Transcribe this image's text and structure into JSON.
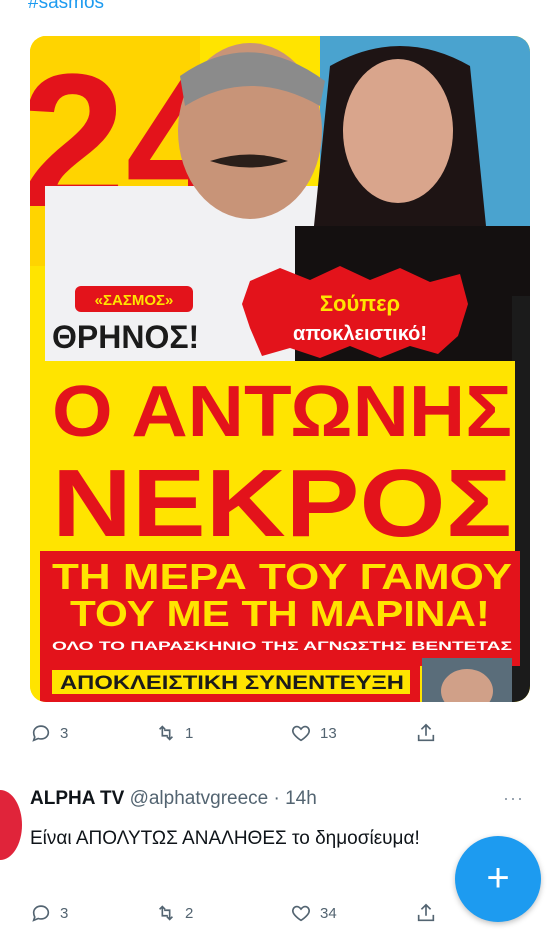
{
  "feed": {
    "hashtag": "#sasmos"
  },
  "magazine": {
    "tag": "«ΣΑΣΜΟΣ»",
    "kicker": "ΘΡΗΝΟΣ!",
    "badge_line1": "Σούπερ",
    "badge_line2": "αποκλειστικό!",
    "headline_line1": "Ο ΑΝΤΩΝΗΣ",
    "headline_line2": "ΝΕΚΡΟΣ",
    "sub_line1": "ΤΗ ΜΕΡΑ ΤΟΥ ΓΑΜΟΥ",
    "sub_line2": "ΤΟΥ ΜΕ ΤΗ ΜΑΡΙΝΑ!",
    "small_line": "ΟΛΟ ΤΟ ΠΑΡΑΣΚΗΝΙΟ ΤΗΣ ΑΓΝΩΣΤΗΣ ΒΕΝΤΕΤΑΣ",
    "bottom_strip": "ΑΠΟΚΛΕΙΣΤΙΚΗ ΣΥΝΕΝΤΕΥΞΗ",
    "issue_number": "24"
  },
  "tweet1": {
    "replies": "3",
    "retweets": "1",
    "likes": "13"
  },
  "tweet2": {
    "name": "ALPHA TV",
    "handle": "@alphatvgreece · 14h",
    "more": "···",
    "text": "Είναι ΑΠΟΛΥΤΩΣ ΑΝΑΛΗΘΕΣ το δημοσίευμα!",
    "replies": "3",
    "retweets": "2",
    "likes": "34"
  },
  "fab": {
    "label": "+"
  },
  "colors": {
    "accent": "#1d9bf0",
    "muted": "#536471",
    "magazine_red": "#e3131b",
    "magazine_yellow": "#ffe400"
  }
}
